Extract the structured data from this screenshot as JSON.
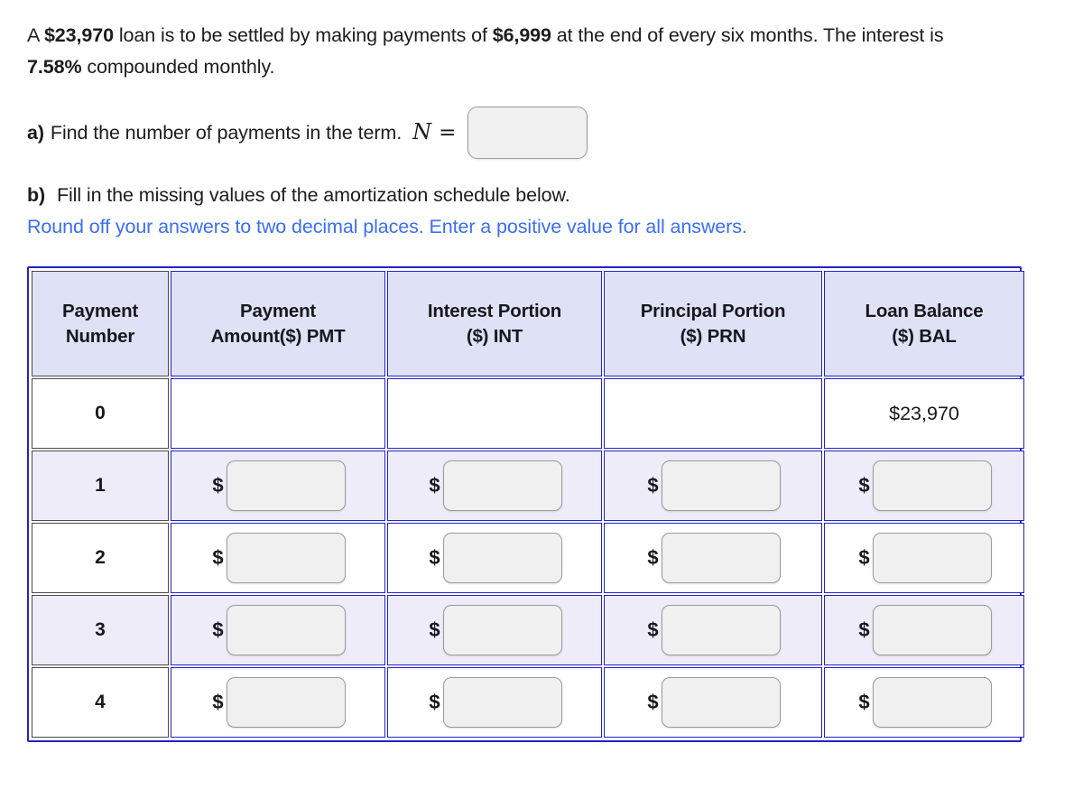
{
  "problem": {
    "sentence_parts": [
      {
        "text": "A ",
        "bold": false
      },
      {
        "text": "$23,970",
        "bold": true
      },
      {
        "text": " loan is to be settled by making payments of ",
        "bold": false
      },
      {
        "text": "$6,999",
        "bold": true
      },
      {
        "text": " at the end of every six months. The interest is ",
        "bold": false
      },
      {
        "text": "7.58%",
        "bold": true
      },
      {
        "text": " compounded monthly.",
        "bold": false
      }
    ],
    "loan_amount": "$23,970",
    "payment_amount": "$6,999",
    "interest_rate": "7.58%",
    "payment_frequency": "every six months",
    "compounding": "monthly"
  },
  "part_a": {
    "label": "a)",
    "text": "Find the number of payments in the term.",
    "variable": "N",
    "equals": "=",
    "input_value": "",
    "input_placeholder": ""
  },
  "part_b": {
    "label": "b)",
    "text": "Fill in the missing values of the amortization schedule below.",
    "note": "Round off your answers to two decimal places. Enter a positive value for all answers.",
    "note_color": "#3b6ef5"
  },
  "table": {
    "headers": [
      {
        "line1": "Payment",
        "line2": "Number"
      },
      {
        "line1": "Payment",
        "line2": "Amount($) PMT"
      },
      {
        "line1": "Interest Portion",
        "line2": "($) INT"
      },
      {
        "line1": "Principal Portion",
        "line2": "($) PRN"
      },
      {
        "line1": "Loan Balance",
        "line2": "($) BAL"
      }
    ],
    "currency_symbol": "$",
    "rows": [
      {
        "number": "0",
        "shaded": false,
        "pmt": {
          "kind": "empty",
          "value": ""
        },
        "int": {
          "kind": "empty",
          "value": ""
        },
        "prn": {
          "kind": "empty",
          "value": ""
        },
        "bal": {
          "kind": "static",
          "value": "$23,970"
        }
      },
      {
        "number": "1",
        "shaded": true,
        "pmt": {
          "kind": "input",
          "value": ""
        },
        "int": {
          "kind": "input",
          "value": ""
        },
        "prn": {
          "kind": "input",
          "value": ""
        },
        "bal": {
          "kind": "input",
          "value": ""
        }
      },
      {
        "number": "2",
        "shaded": false,
        "pmt": {
          "kind": "input",
          "value": ""
        },
        "int": {
          "kind": "input",
          "value": ""
        },
        "prn": {
          "kind": "input",
          "value": ""
        },
        "bal": {
          "kind": "input",
          "value": ""
        }
      },
      {
        "number": "3",
        "shaded": true,
        "pmt": {
          "kind": "input",
          "value": ""
        },
        "int": {
          "kind": "input",
          "value": ""
        },
        "prn": {
          "kind": "input",
          "value": ""
        },
        "bal": {
          "kind": "input",
          "value": ""
        }
      },
      {
        "number": "4",
        "shaded": false,
        "pmt": {
          "kind": "input",
          "value": ""
        },
        "int": {
          "kind": "input",
          "value": ""
        },
        "prn": {
          "kind": "input",
          "value": ""
        },
        "bal": {
          "kind": "input",
          "value": ""
        }
      }
    ]
  },
  "colors": {
    "header_bg": "#dfe2f6",
    "row_shade": "#efecfa",
    "table_border": "#2222c8",
    "note_blue": "#3b6ef5",
    "input_bg": "#f0f0f0",
    "input_border": "#9b9b9b"
  }
}
